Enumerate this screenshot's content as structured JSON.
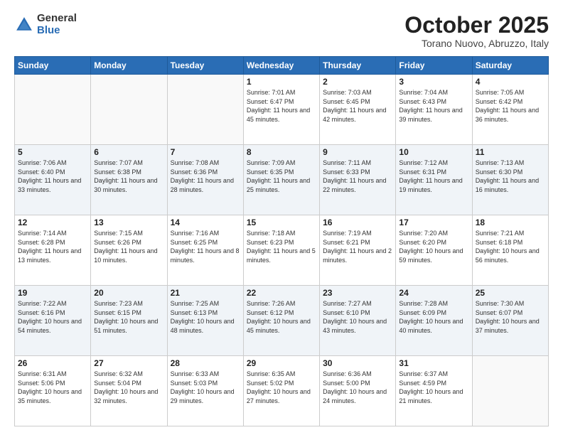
{
  "header": {
    "logo_general": "General",
    "logo_blue": "Blue",
    "month_title": "October 2025",
    "location": "Torano Nuovo, Abruzzo, Italy"
  },
  "days_of_week": [
    "Sunday",
    "Monday",
    "Tuesday",
    "Wednesday",
    "Thursday",
    "Friday",
    "Saturday"
  ],
  "weeks": [
    [
      {
        "day": "",
        "info": ""
      },
      {
        "day": "",
        "info": ""
      },
      {
        "day": "",
        "info": ""
      },
      {
        "day": "1",
        "info": "Sunrise: 7:01 AM\nSunset: 6:47 PM\nDaylight: 11 hours and 45 minutes."
      },
      {
        "day": "2",
        "info": "Sunrise: 7:03 AM\nSunset: 6:45 PM\nDaylight: 11 hours and 42 minutes."
      },
      {
        "day": "3",
        "info": "Sunrise: 7:04 AM\nSunset: 6:43 PM\nDaylight: 11 hours and 39 minutes."
      },
      {
        "day": "4",
        "info": "Sunrise: 7:05 AM\nSunset: 6:42 PM\nDaylight: 11 hours and 36 minutes."
      }
    ],
    [
      {
        "day": "5",
        "info": "Sunrise: 7:06 AM\nSunset: 6:40 PM\nDaylight: 11 hours and 33 minutes."
      },
      {
        "day": "6",
        "info": "Sunrise: 7:07 AM\nSunset: 6:38 PM\nDaylight: 11 hours and 30 minutes."
      },
      {
        "day": "7",
        "info": "Sunrise: 7:08 AM\nSunset: 6:36 PM\nDaylight: 11 hours and 28 minutes."
      },
      {
        "day": "8",
        "info": "Sunrise: 7:09 AM\nSunset: 6:35 PM\nDaylight: 11 hours and 25 minutes."
      },
      {
        "day": "9",
        "info": "Sunrise: 7:11 AM\nSunset: 6:33 PM\nDaylight: 11 hours and 22 minutes."
      },
      {
        "day": "10",
        "info": "Sunrise: 7:12 AM\nSunset: 6:31 PM\nDaylight: 11 hours and 19 minutes."
      },
      {
        "day": "11",
        "info": "Sunrise: 7:13 AM\nSunset: 6:30 PM\nDaylight: 11 hours and 16 minutes."
      }
    ],
    [
      {
        "day": "12",
        "info": "Sunrise: 7:14 AM\nSunset: 6:28 PM\nDaylight: 11 hours and 13 minutes."
      },
      {
        "day": "13",
        "info": "Sunrise: 7:15 AM\nSunset: 6:26 PM\nDaylight: 11 hours and 10 minutes."
      },
      {
        "day": "14",
        "info": "Sunrise: 7:16 AM\nSunset: 6:25 PM\nDaylight: 11 hours and 8 minutes."
      },
      {
        "day": "15",
        "info": "Sunrise: 7:18 AM\nSunset: 6:23 PM\nDaylight: 11 hours and 5 minutes."
      },
      {
        "day": "16",
        "info": "Sunrise: 7:19 AM\nSunset: 6:21 PM\nDaylight: 11 hours and 2 minutes."
      },
      {
        "day": "17",
        "info": "Sunrise: 7:20 AM\nSunset: 6:20 PM\nDaylight: 10 hours and 59 minutes."
      },
      {
        "day": "18",
        "info": "Sunrise: 7:21 AM\nSunset: 6:18 PM\nDaylight: 10 hours and 56 minutes."
      }
    ],
    [
      {
        "day": "19",
        "info": "Sunrise: 7:22 AM\nSunset: 6:16 PM\nDaylight: 10 hours and 54 minutes."
      },
      {
        "day": "20",
        "info": "Sunrise: 7:23 AM\nSunset: 6:15 PM\nDaylight: 10 hours and 51 minutes."
      },
      {
        "day": "21",
        "info": "Sunrise: 7:25 AM\nSunset: 6:13 PM\nDaylight: 10 hours and 48 minutes."
      },
      {
        "day": "22",
        "info": "Sunrise: 7:26 AM\nSunset: 6:12 PM\nDaylight: 10 hours and 45 minutes."
      },
      {
        "day": "23",
        "info": "Sunrise: 7:27 AM\nSunset: 6:10 PM\nDaylight: 10 hours and 43 minutes."
      },
      {
        "day": "24",
        "info": "Sunrise: 7:28 AM\nSunset: 6:09 PM\nDaylight: 10 hours and 40 minutes."
      },
      {
        "day": "25",
        "info": "Sunrise: 7:30 AM\nSunset: 6:07 PM\nDaylight: 10 hours and 37 minutes."
      }
    ],
    [
      {
        "day": "26",
        "info": "Sunrise: 6:31 AM\nSunset: 5:06 PM\nDaylight: 10 hours and 35 minutes."
      },
      {
        "day": "27",
        "info": "Sunrise: 6:32 AM\nSunset: 5:04 PM\nDaylight: 10 hours and 32 minutes."
      },
      {
        "day": "28",
        "info": "Sunrise: 6:33 AM\nSunset: 5:03 PM\nDaylight: 10 hours and 29 minutes."
      },
      {
        "day": "29",
        "info": "Sunrise: 6:35 AM\nSunset: 5:02 PM\nDaylight: 10 hours and 27 minutes."
      },
      {
        "day": "30",
        "info": "Sunrise: 6:36 AM\nSunset: 5:00 PM\nDaylight: 10 hours and 24 minutes."
      },
      {
        "day": "31",
        "info": "Sunrise: 6:37 AM\nSunset: 4:59 PM\nDaylight: 10 hours and 21 minutes."
      },
      {
        "day": "",
        "info": ""
      }
    ]
  ]
}
